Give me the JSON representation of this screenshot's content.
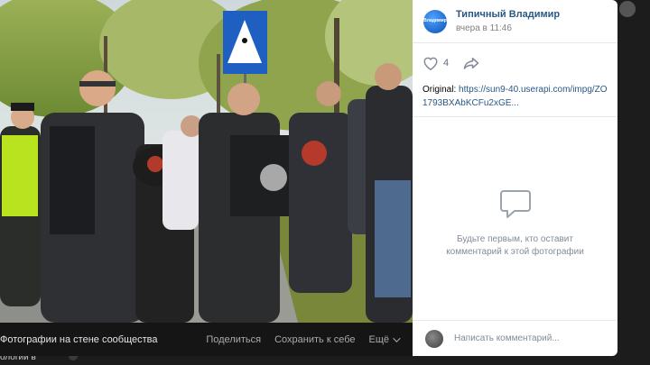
{
  "post": {
    "author_name": "Типичный Владимир",
    "author_avatar_text": "Владимир",
    "time": "вчера в 11:46",
    "likes": "4",
    "original_label": "Original:",
    "original_link": "https://sun9-40.userapi.com/impg/ZO1793BXAbKCFu2xGE..."
  },
  "viewer": {
    "album_title": "Фотографии на стене сообщества",
    "share_label": "Поделиться",
    "save_label": "Сохранить к себе",
    "more_label": "Ещё"
  },
  "comments": {
    "empty_text": "Будьте первым, кто оставит комментарий к этой фотографии",
    "input_placeholder": "Написать комментарий..."
  },
  "background": {
    "partial_text": "ологии в"
  },
  "colors": {
    "link": "#2a5885",
    "muted": "#818c99",
    "viewer_bar": "#151515"
  }
}
